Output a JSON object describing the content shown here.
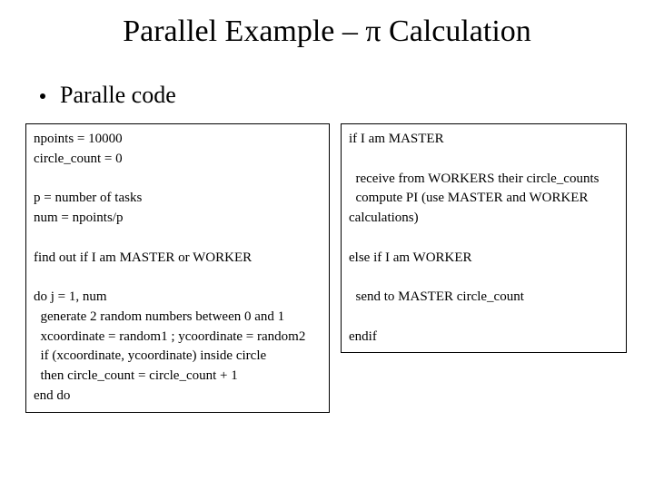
{
  "title": "Parallel Example – π Calculation",
  "bullet": "Paralle code",
  "left_code": "npoints = 10000\ncircle_count = 0\n\np = number of tasks\nnum = npoints/p\n\nfind out if I am MASTER or WORKER\n\ndo j = 1, num\n  generate 2 random numbers between 0 and 1\n  xcoordinate = random1 ; ycoordinate = random2\n  if (xcoordinate, ycoordinate) inside circle\n  then circle_count = circle_count + 1\nend do",
  "right_code": "if I am MASTER\n\n  receive from WORKERS their circle_counts\n  compute PI (use MASTER and WORKER\ncalculations)\n\nelse if I am WORKER\n\n  send to MASTER circle_count\n\nendif"
}
